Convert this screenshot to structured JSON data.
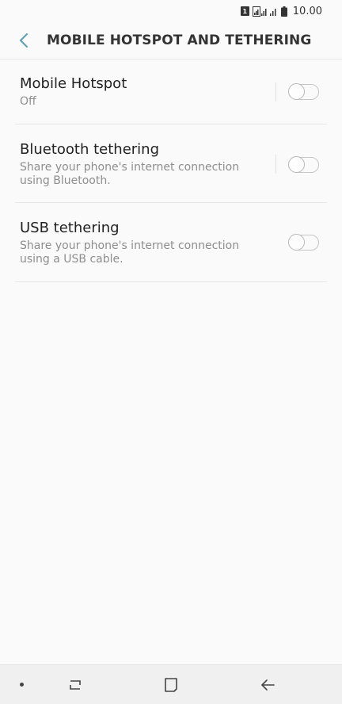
{
  "status_bar": {
    "sim_label": "1",
    "time": "10.00"
  },
  "header": {
    "title": "MOBILE HOTSPOT AND TETHERING",
    "accent_color": "#5a9fb0"
  },
  "settings": [
    {
      "label": "Mobile Hotspot",
      "sub": "Off",
      "enabled": false
    },
    {
      "label": "Bluetooth tethering",
      "sub": "Share your phone's internet connection using Bluetooth.",
      "enabled": false
    },
    {
      "label": "USB tethering",
      "sub": "Share your phone's internet connection using a USB cable.",
      "enabled": false
    }
  ],
  "nav_bar": {
    "icons": [
      "dot-icon",
      "recent-apps-icon",
      "home-icon",
      "back-icon"
    ]
  }
}
